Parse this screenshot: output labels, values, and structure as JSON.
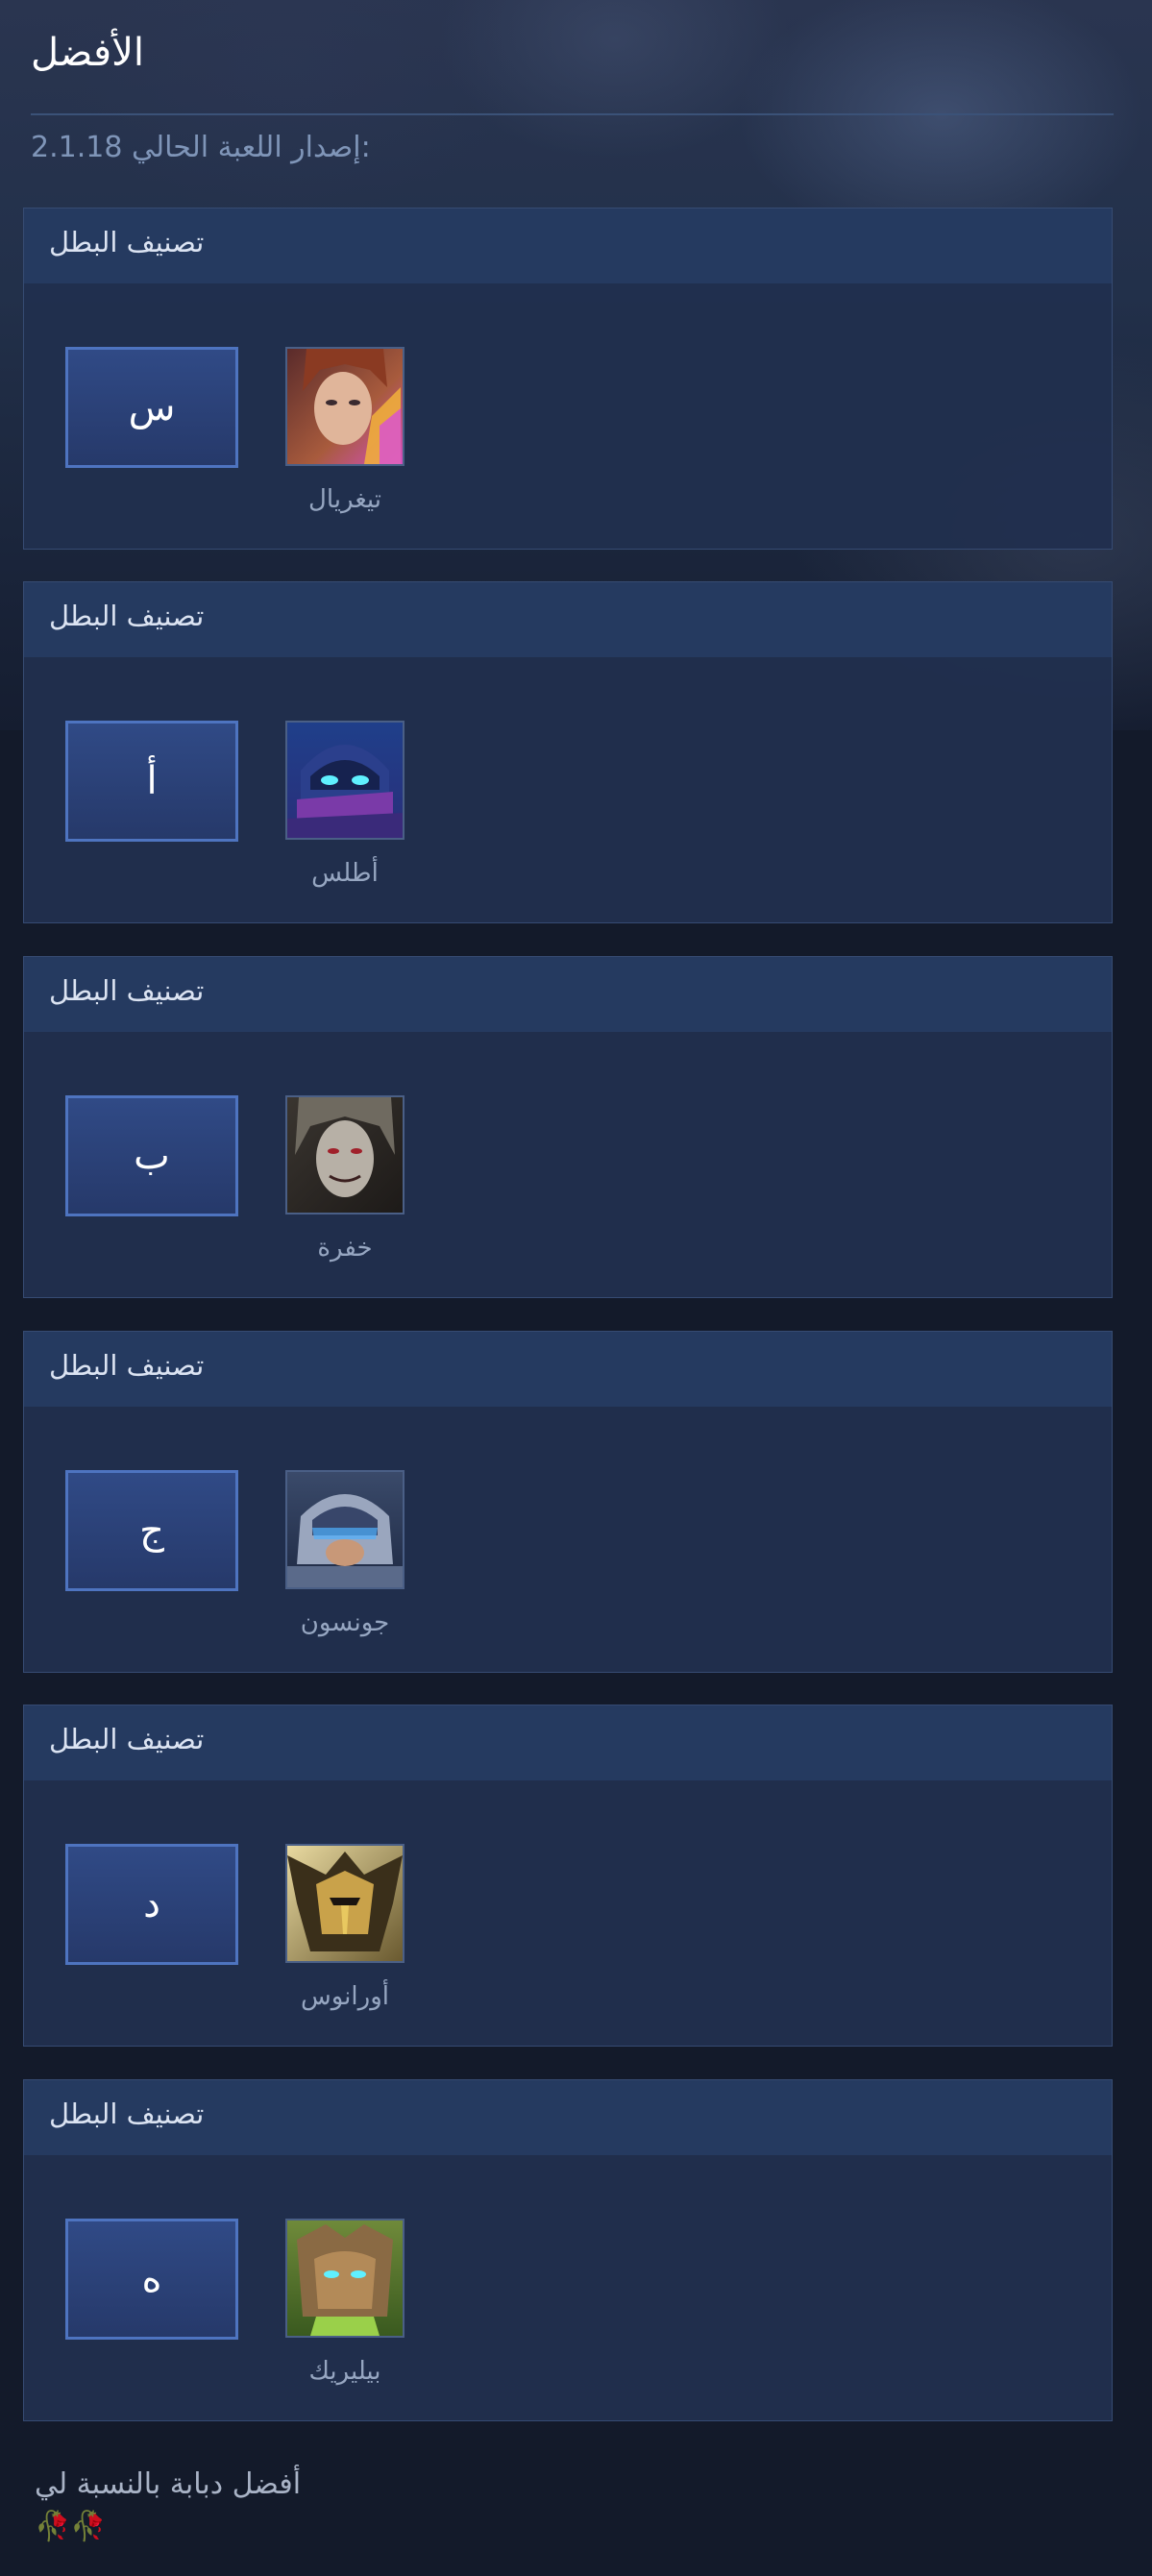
{
  "header": {
    "title": "الأفضل",
    "version_text": "2.1.18 إصدار اللعبة الحالي:"
  },
  "cards": [
    {
      "title": "تصنيف البطل",
      "grade": "س",
      "hero": "تيغريال",
      "portrait_icon": "tigreal-portrait"
    },
    {
      "title": "تصنيف البطل",
      "grade": "أ",
      "hero": "أطلس",
      "portrait_icon": "atlas-portrait"
    },
    {
      "title": "تصنيف البطل",
      "grade": "ب",
      "hero": "خفرة",
      "portrait_icon": "khufra-portrait"
    },
    {
      "title": "تصنيف البطل",
      "grade": "ج",
      "hero": "جونسون",
      "portrait_icon": "johnson-portrait"
    },
    {
      "title": "تصنيف البطل",
      "grade": "د",
      "hero": "أورانوس",
      "portrait_icon": "uranus-portrait"
    },
    {
      "title": "تصنيف البطل",
      "grade": "ه",
      "hero": "بيليريك",
      "portrait_icon": "belerick-portrait"
    }
  ],
  "footer": {
    "note": "أفضل دبابة بالنسبة لي",
    "emoji": "🥀🥀"
  },
  "colors": {
    "background": "#131a2a",
    "card": "#212f4e",
    "card_header": "#253a60",
    "grade_border": "#4e74c0",
    "grade_fill": "#2c4479",
    "version_text": "#7f95b8"
  }
}
